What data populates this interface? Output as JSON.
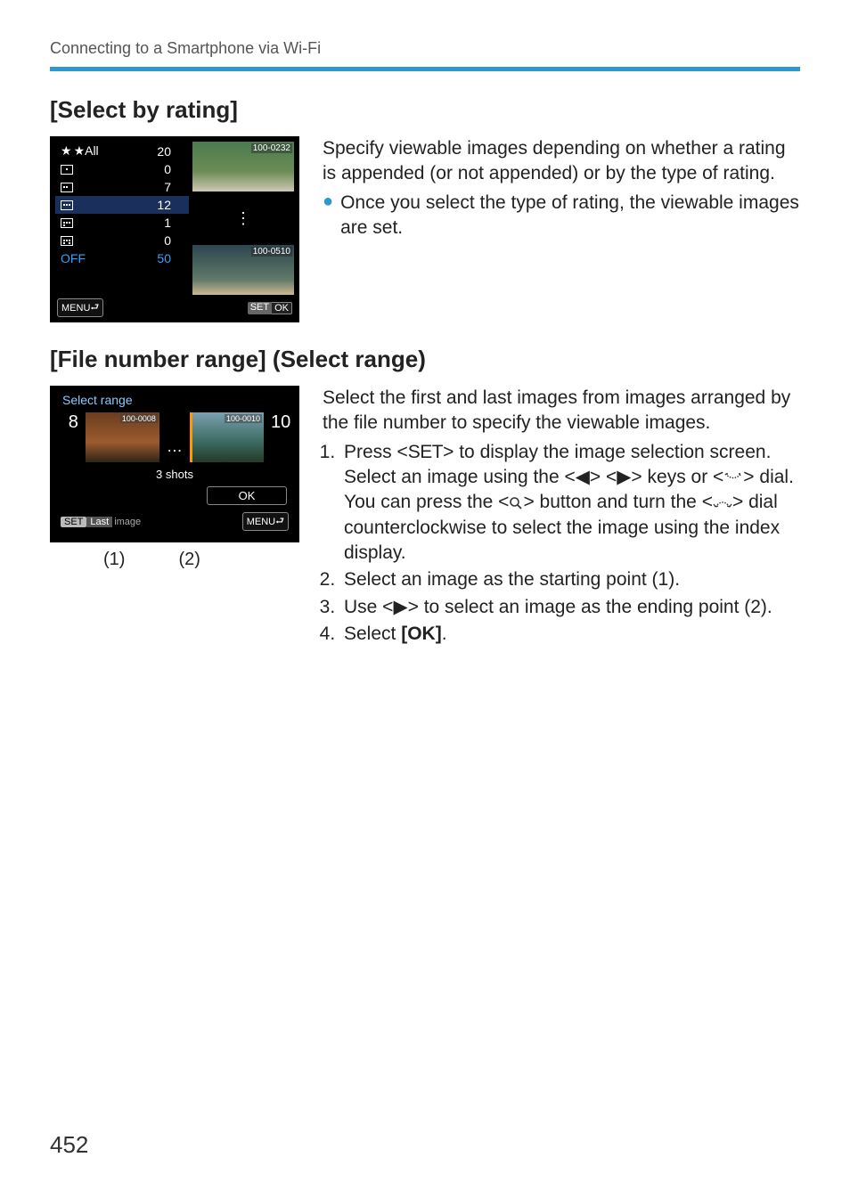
{
  "header": "Connecting to a Smartphone via Wi-Fi",
  "page_number": "452",
  "section1": {
    "title": "[Select by rating]",
    "intro": "Specify viewable images depending on whether a rating is appended (or not appended) or by the type of rating.",
    "bullet": "Once you select the type of rating, the viewable images are set.",
    "lcd": {
      "rows": [
        {
          "label": "★All",
          "count": "20",
          "kind": "all",
          "selected": false
        },
        {
          "label": "",
          "count": "0",
          "kind": "1",
          "selected": false
        },
        {
          "label": "",
          "count": "7",
          "kind": "2",
          "selected": false
        },
        {
          "label": "",
          "count": "12",
          "kind": "3",
          "selected": true
        },
        {
          "label": "",
          "count": "1",
          "kind": "4",
          "selected": false
        },
        {
          "label": "",
          "count": "0",
          "kind": "5",
          "selected": false
        },
        {
          "label": "OFF",
          "count": "50",
          "kind": "off",
          "selected": false
        }
      ],
      "thumb1_tag": "100-0232",
      "thumb2_tag": "100-0510",
      "menu_label": "MENU",
      "set_label": "SET",
      "ok_label": "OK"
    }
  },
  "section2": {
    "title": "[File number range] (Select range)",
    "intro": "Select the first and last images from images arranged by the file number to specify the viewable images.",
    "steps": {
      "s1a": "Press <",
      "s1set": "SET",
      "s1b": "> to display the image selection screen.",
      "s1c": "Select an image using the <◀> <▶> keys or <",
      "s1d": "> dial.",
      "s1e": "You can press the <",
      "s1f": "> button and turn the <",
      "s1g": "> dial counterclockwise to select the image using the index display.",
      "s2": "Select an image as the starting point (1).",
      "s3": "Use <▶> to select an image as the ending point (2).",
      "s4a": "Select ",
      "s4b": "[OK]",
      "s4c": "."
    },
    "lcd": {
      "title": "Select range",
      "left_num": "8",
      "left_tag": "100-0008",
      "right_num": "10",
      "right_tag": "100-0010",
      "shots": "3 shots",
      "ok": "OK",
      "set": "SET",
      "last": "Last",
      "image": "image",
      "menu": "MENU"
    },
    "callout1": "(1)",
    "callout2": "(2)"
  }
}
